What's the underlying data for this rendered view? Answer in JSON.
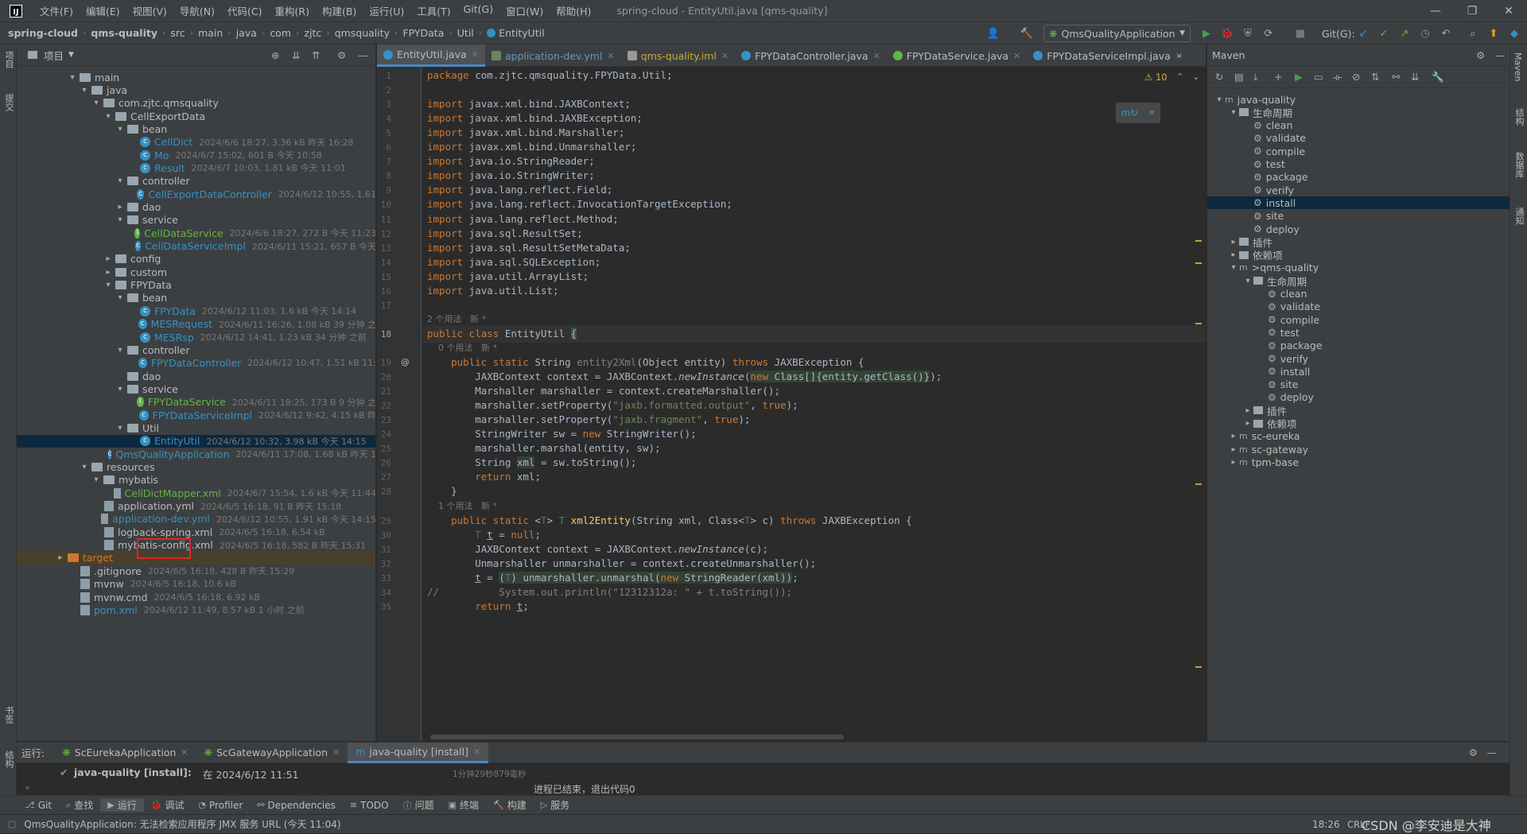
{
  "menu": {
    "items": [
      "文件(F)",
      "编辑(E)",
      "视图(V)",
      "导航(N)",
      "代码(C)",
      "重构(R)",
      "构建(B)",
      "运行(U)",
      "工具(T)",
      "Git(G)",
      "窗口(W)",
      "帮助(H)"
    ],
    "window_title": "spring-cloud - EntityUtil.java [qms-quality]"
  },
  "nav": {
    "crumbs": [
      "spring-cloud",
      "qms-quality",
      "src",
      "main",
      "java",
      "com",
      "zjtc",
      "qmsquality",
      "FPYData",
      "Util",
      "EntityUtil"
    ],
    "run_config": "QmsQualityApplication",
    "git_label": "Git(G):"
  },
  "left_stripe": {
    "project": "项目",
    "commit": "提交",
    "bookmarks": "书签",
    "structure": "结构"
  },
  "right_stripe": {
    "maven": "Maven",
    "structure": "结构",
    "database": "数据库",
    "notifications": "通知"
  },
  "project": {
    "title": "项目",
    "tree": [
      {
        "indent": 3,
        "arrow": "▾",
        "icon": "folder",
        "name": "main",
        "meta": ""
      },
      {
        "indent": 4,
        "arrow": "▾",
        "icon": "folder",
        "name": "java",
        "meta": ""
      },
      {
        "indent": 5,
        "arrow": "▾",
        "icon": "folder",
        "name": "com.zjtc.qmsquality",
        "meta": ""
      },
      {
        "indent": 6,
        "arrow": "▾",
        "icon": "folder",
        "name": "CellExportData",
        "meta": ""
      },
      {
        "indent": 7,
        "arrow": "▾",
        "icon": "folder",
        "name": "bean",
        "meta": ""
      },
      {
        "indent": 8,
        "arrow": "",
        "icon": "class",
        "name": "CellDict",
        "meta": "2024/6/6 18:27, 3.36 kB 昨天 16:28",
        "color": "blue"
      },
      {
        "indent": 8,
        "arrow": "",
        "icon": "class",
        "name": "Mo",
        "meta": "2024/6/7 15:02, 601 B 今天 10:58",
        "color": "blue"
      },
      {
        "indent": 8,
        "arrow": "",
        "icon": "class",
        "name": "Result",
        "meta": "2024/6/7 10:03, 1.81 kB 今天 11:01",
        "color": "blue"
      },
      {
        "indent": 7,
        "arrow": "▾",
        "icon": "folder",
        "name": "controller",
        "meta": ""
      },
      {
        "indent": 8,
        "arrow": "",
        "icon": "class",
        "name": "CellExportDataController",
        "meta": "2024/6/12 10:55, 1.61",
        "color": "blue"
      },
      {
        "indent": 7,
        "arrow": "▸",
        "icon": "folder",
        "name": "dao",
        "meta": ""
      },
      {
        "indent": 7,
        "arrow": "▾",
        "icon": "folder",
        "name": "service",
        "meta": ""
      },
      {
        "indent": 8,
        "arrow": "",
        "icon": "svc",
        "name": "CellDataService",
        "meta": "2024/6/6 18:27, 272 B 今天 11:23",
        "color": "green"
      },
      {
        "indent": 8,
        "arrow": "",
        "icon": "class",
        "name": "CellDataServiceImpl",
        "meta": "2024/6/11 15:21, 657 B 今天",
        "color": "blue"
      },
      {
        "indent": 6,
        "arrow": "▸",
        "icon": "folder",
        "name": "config",
        "meta": ""
      },
      {
        "indent": 6,
        "arrow": "▸",
        "icon": "folder",
        "name": "custom",
        "meta": ""
      },
      {
        "indent": 6,
        "arrow": "▾",
        "icon": "folder",
        "name": "FPYData",
        "meta": ""
      },
      {
        "indent": 7,
        "arrow": "▾",
        "icon": "folder",
        "name": "bean",
        "meta": ""
      },
      {
        "indent": 8,
        "arrow": "",
        "icon": "class",
        "name": "FPYData",
        "meta": "2024/6/12 11:03, 1.6 kB 今天 14:14",
        "color": "blue"
      },
      {
        "indent": 8,
        "arrow": "",
        "icon": "class",
        "name": "MESRequest",
        "meta": "2024/6/11 16:26, 1.08 kB 39 分钟 之",
        "color": "blue"
      },
      {
        "indent": 8,
        "arrow": "",
        "icon": "class",
        "name": "MESRsp",
        "meta": "2024/6/12 14:41, 1.23 kB 34 分钟 之前",
        "color": "blue"
      },
      {
        "indent": 7,
        "arrow": "▾",
        "icon": "folder",
        "name": "controller",
        "meta": ""
      },
      {
        "indent": 8,
        "arrow": "",
        "icon": "class",
        "name": "FPYDataController",
        "meta": "2024/6/12 10:47, 1.51 kB 11:",
        "color": "blue"
      },
      {
        "indent": 7,
        "arrow": "",
        "icon": "folder",
        "name": "dao",
        "meta": ""
      },
      {
        "indent": 7,
        "arrow": "▾",
        "icon": "folder",
        "name": "service",
        "meta": ""
      },
      {
        "indent": 8,
        "arrow": "",
        "icon": "svc",
        "name": "FPYDataService",
        "meta": "2024/6/11 18:25, 173 B 9 分钟 之",
        "color": "green"
      },
      {
        "indent": 8,
        "arrow": "",
        "icon": "class",
        "name": "FPYDataServiceImpl",
        "meta": "2024/6/12 9:42, 4.15 kB 昨",
        "color": "blue"
      },
      {
        "indent": 7,
        "arrow": "▾",
        "icon": "folder",
        "name": "Util",
        "meta": ""
      },
      {
        "indent": 8,
        "arrow": "",
        "icon": "class",
        "name": "EntityUtil",
        "meta": "2024/6/12 10:32, 3.98 kB 今天 14:15",
        "color": "blue",
        "selected": true
      },
      {
        "indent": 6,
        "arrow": "",
        "icon": "class",
        "name": "QmsQualityApplication",
        "meta": "2024/6/11 17:08, 1.68 kB 昨天 1",
        "color": "blue"
      },
      {
        "indent": 4,
        "arrow": "▾",
        "icon": "folder",
        "name": "resources",
        "meta": ""
      },
      {
        "indent": 5,
        "arrow": "▾",
        "icon": "folder",
        "name": "mybatis",
        "meta": ""
      },
      {
        "indent": 6,
        "arrow": "",
        "icon": "file",
        "name": "CellDictMapper.xml",
        "meta": "2024/6/7 15:54, 1.6 kB 今天 11:44",
        "color": "green"
      },
      {
        "indent": 5,
        "arrow": "",
        "icon": "file",
        "name": "application.yml",
        "meta": "2024/6/5 16:18, 91 B 昨天 15:18"
      },
      {
        "indent": 5,
        "arrow": "",
        "icon": "file",
        "name": "application-dev.yml",
        "meta": "2024/6/12 10:55, 1.91 kB 今天 14:15",
        "color": "blue"
      },
      {
        "indent": 5,
        "arrow": "",
        "icon": "file",
        "name": "logback-spring.xml",
        "meta": "2024/6/5 16:18, 6.54 kB"
      },
      {
        "indent": 5,
        "arrow": "",
        "icon": "file",
        "name": "mybatis-config.xml",
        "meta": "2024/6/5 16:18, 582 B 昨天 15:31"
      },
      {
        "indent": 2,
        "arrow": "▸",
        "icon": "orange",
        "name": "target",
        "meta": "",
        "color": "orange",
        "band": true
      },
      {
        "indent": 3,
        "arrow": "",
        "icon": "file",
        "name": ".gitignore",
        "meta": "2024/6/5 16:18, 428 B 昨天 15:29"
      },
      {
        "indent": 3,
        "arrow": "",
        "icon": "file",
        "name": "mvnw",
        "meta": "2024/6/5 16:18, 10.6 kB"
      },
      {
        "indent": 3,
        "arrow": "",
        "icon": "file",
        "name": "mvnw.cmd",
        "meta": "2024/6/5 16:18, 6.92 kB"
      },
      {
        "indent": 3,
        "arrow": "",
        "icon": "file",
        "name": "pom.xml",
        "meta": "2024/6/12 11:49, 8.57 kB 1 小时 之前",
        "color": "blue"
      }
    ]
  },
  "editor": {
    "tabs": [
      {
        "label": "EntityUtil.java",
        "icon": "class",
        "active": true
      },
      {
        "label": "application-dev.yml",
        "icon": "yml"
      },
      {
        "label": "qms-quality.iml",
        "icon": "iml"
      },
      {
        "label": "FPYDataController.java",
        "icon": "class"
      },
      {
        "label": "FPYDataService.java",
        "icon": "svc"
      },
      {
        "label": "FPYDataServiceImpl.java",
        "icon": "class"
      }
    ],
    "warnings": "⚠ 10",
    "lines": [
      {
        "n": "1",
        "h": "<span class='kw'>package</span> com.zjtc.qmsquality.FPYData.Util;"
      },
      {
        "n": "2",
        "h": ""
      },
      {
        "n": "3",
        "h": "<span class='kw'>import</span> javax.xml.bind.JAXBContext;"
      },
      {
        "n": "4",
        "h": "<span class='kw'>import</span> javax.xml.bind.JAXBException;"
      },
      {
        "n": "5",
        "h": "<span class='kw'>import</span> javax.xml.bind.Marshaller;"
      },
      {
        "n": "6",
        "h": "<span class='kw'>import</span> javax.xml.bind.Unmarshaller;"
      },
      {
        "n": "7",
        "h": "<span class='kw'>import</span> java.io.StringReader;"
      },
      {
        "n": "8",
        "h": "<span class='kw'>import</span> java.io.StringWriter;"
      },
      {
        "n": "9",
        "h": "<span class='kw'>import</span> java.lang.reflect.Field;"
      },
      {
        "n": "10",
        "h": "<span class='kw'>import</span> java.lang.reflect.InvocationTargetException;"
      },
      {
        "n": "11",
        "h": "<span class='kw'>import</span> java.lang.reflect.Method;"
      },
      {
        "n": "12",
        "h": "<span class='kw'>import</span> java.sql.ResultSet;"
      },
      {
        "n": "13",
        "h": "<span class='kw'>import</span> java.sql.ResultSetMetaData;"
      },
      {
        "n": "14",
        "h": "<span class='kw'>import</span> java.sql.SQLException;"
      },
      {
        "n": "15",
        "h": "<span class='kw'>import</span> java.util.ArrayList;"
      },
      {
        "n": "16",
        "h": "<span class='kw'>import</span> java.util.List;"
      },
      {
        "n": "17",
        "h": ""
      },
      {
        "n": "",
        "h": "2 个用法   新 *",
        "hint": true
      },
      {
        "n": "18",
        "h": "<span class='kw'>public class</span> EntityUtil <span class='bracehl'>{</span>",
        "cur": true
      },
      {
        "n": "",
        "h": "    0 个用法   新 *",
        "hint": true
      },
      {
        "n": "19",
        "h": "    <span class='kw'>public static</span> String <span class='cm'>entity2Xml</span>(Object entity) <span class='kw'>throws</span> JAXBException {"
      },
      {
        "n": "20",
        "h": "        JAXBContext context = JAXBContext.<span class='it'>newInstance</span>(<span class='hl'><span class='kw'>new</span> Class[]{entity.getClass()}</span>);"
      },
      {
        "n": "21",
        "h": "        Marshaller marshaller = context.createMarshaller();"
      },
      {
        "n": "22",
        "h": "        marshaller.setProperty(<span class='str'>\"jaxb.formatted.output\"</span>, <span class='kw'>true</span>);"
      },
      {
        "n": "23",
        "h": "        marshaller.setProperty(<span class='str'>\"jaxb.fragment\"</span>, <span class='kw'>true</span>);"
      },
      {
        "n": "24",
        "h": "        StringWriter sw = <span class='kw'>new</span> StringWriter();"
      },
      {
        "n": "25",
        "h": "        marshaller.marshal(entity, sw);"
      },
      {
        "n": "26",
        "h": "        String <span class='hl'>xml</span> = sw.toString();"
      },
      {
        "n": "27",
        "h": "        <span class='kw'>return</span> xml;"
      },
      {
        "n": "28",
        "h": "    }"
      },
      {
        "n": "",
        "h": "    1 个用法   新 *",
        "hint": true
      },
      {
        "n": "29",
        "h": "    <span class='kw'>public static</span> &lt;<span class='gen'>T</span>&gt; <span class='gen'>T</span> <span class='fn'>xml2Entity</span>(String xml, Class&lt;<span class='gen'>T</span>&gt; c) <span class='kw'>throws</span> JAXBException {"
      },
      {
        "n": "30",
        "h": "        <span class='gen'>T</span> <u>t</u> = <span class='kw'>null</span>;"
      },
      {
        "n": "31",
        "h": "        JAXBContext context = JAXBContext.<span class='it'>newInstance</span>(c);"
      },
      {
        "n": "32",
        "h": "        Unmarshaller unmarshaller = context.createUnmarshaller();"
      },
      {
        "n": "33",
        "h": "        <u>t</u> = <span class='hl'>(<span class='gen'>T</span>) unmarshaller.unmarshal(<span class='kw'>new</span> StringReader(xml))</span>;"
      },
      {
        "n": "34",
        "h": "<span class='cm'>//          System.out.println(\"12312312a: \" + t.toString());</span>"
      },
      {
        "n": "35",
        "h": "        <span class='kw'>return</span> <u>t</u>;"
      }
    ]
  },
  "maven": {
    "title": "Maven",
    "rows": [
      {
        "indent": 0,
        "arrow": "▾",
        "icon": "proj",
        "label": "java-quality"
      },
      {
        "indent": 1,
        "arrow": "▾",
        "icon": "folder",
        "label": "生命周期"
      },
      {
        "indent": 2,
        "icon": "gear",
        "label": "clean"
      },
      {
        "indent": 2,
        "icon": "gear",
        "label": "validate"
      },
      {
        "indent": 2,
        "icon": "gear",
        "label": "compile"
      },
      {
        "indent": 2,
        "icon": "gear",
        "label": "test"
      },
      {
        "indent": 2,
        "icon": "gear",
        "label": "package"
      },
      {
        "indent": 2,
        "icon": "gear",
        "label": "verify"
      },
      {
        "indent": 2,
        "icon": "gear",
        "label": "install",
        "selected": true
      },
      {
        "indent": 2,
        "icon": "gear",
        "label": "site"
      },
      {
        "indent": 2,
        "icon": "gear",
        "label": "deploy"
      },
      {
        "indent": 1,
        "arrow": "▸",
        "icon": "folder",
        "label": "插件"
      },
      {
        "indent": 1,
        "arrow": "▸",
        "icon": "folder",
        "label": "依赖项"
      },
      {
        "indent": 1,
        "arrow": "▾",
        "icon": "proj",
        "label": ">qms-quality"
      },
      {
        "indent": 2,
        "arrow": "▾",
        "icon": "folder",
        "label": "生命周期"
      },
      {
        "indent": 3,
        "icon": "gear",
        "label": "clean"
      },
      {
        "indent": 3,
        "icon": "gear",
        "label": "validate"
      },
      {
        "indent": 3,
        "icon": "gear",
        "label": "compile"
      },
      {
        "indent": 3,
        "icon": "gear",
        "label": "test"
      },
      {
        "indent": 3,
        "icon": "gear",
        "label": "package"
      },
      {
        "indent": 3,
        "icon": "gear",
        "label": "verify"
      },
      {
        "indent": 3,
        "icon": "gear",
        "label": "install"
      },
      {
        "indent": 3,
        "icon": "gear",
        "label": "site"
      },
      {
        "indent": 3,
        "icon": "gear",
        "label": "deploy"
      },
      {
        "indent": 2,
        "arrow": "▸",
        "icon": "folder",
        "label": "插件"
      },
      {
        "indent": 2,
        "arrow": "▸",
        "icon": "folder",
        "label": "依赖项"
      },
      {
        "indent": 1,
        "arrow": "▸",
        "icon": "proj",
        "label": "sc-eureka"
      },
      {
        "indent": 1,
        "arrow": "▸",
        "icon": "proj",
        "label": "sc-gateway"
      },
      {
        "indent": 1,
        "arrow": "▸",
        "icon": "proj",
        "label": "tpm-base"
      }
    ]
  },
  "run": {
    "label": "运行:",
    "tabs": [
      "ScEurekaApplication",
      "ScGatewayApplication",
      "java-quality [install]"
    ],
    "task": "java-quality [install]:",
    "task_time": "在 2024/6/12 11:51",
    "duration": "1分钟29秒879毫秒",
    "output": "进程已结束，退出代码0"
  },
  "bottombar": [
    "Git",
    "查找",
    "运行",
    "调试",
    "Profiler",
    "Dependencies",
    "TODO",
    "问题",
    "终端",
    "构建",
    "服务"
  ],
  "status": {
    "message": "QmsQualityApplication: 无法检索应用程序 JMX 服务 URL (今天 11:04)",
    "position": "18:26",
    "encoding": "CRLF",
    "watermark": "CSDN @李安迪是大神"
  }
}
